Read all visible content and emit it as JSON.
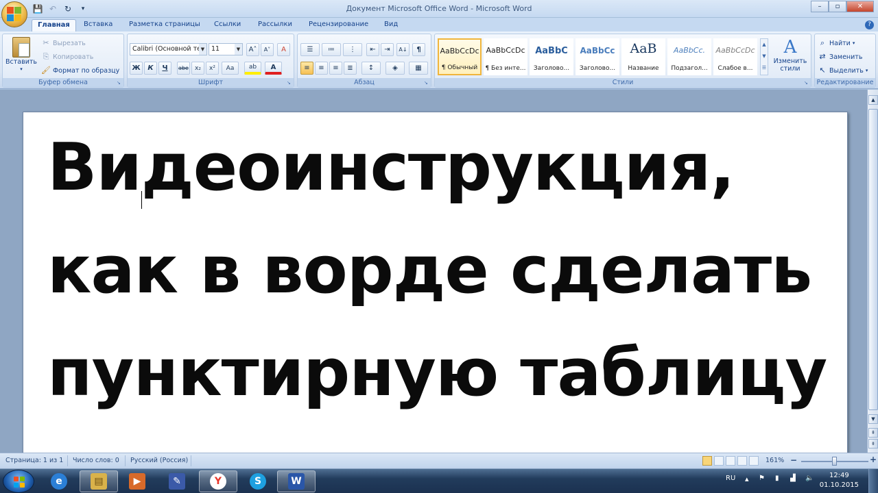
{
  "window": {
    "title": "Документ Microsoft Office Word - Microsoft Word",
    "controls": {
      "minimize": "–",
      "maximize": "▫",
      "close": "✕"
    }
  },
  "quick_access": {
    "save": "💾",
    "undo": "↶",
    "redo": "↻",
    "customize": "▾"
  },
  "tabs": [
    "Главная",
    "Вставка",
    "Разметка страницы",
    "Ссылки",
    "Рассылки",
    "Рецензирование",
    "Вид"
  ],
  "help": "?",
  "ribbon": {
    "clipboard": {
      "label": "Буфер обмена",
      "paste": "Вставить",
      "cut": "Вырезать",
      "copy": "Копировать",
      "format_painter": "Формат по образцу"
    },
    "font": {
      "label": "Шрифт",
      "font_name": "Calibri (Основной текст)",
      "font_size": "11",
      "grow": "A˄",
      "shrink": "A˅",
      "clear": "A",
      "bold": "Ж",
      "italic": "К",
      "underline": "Ч",
      "strike": "abe",
      "subscript": "x₂",
      "superscript": "x²",
      "case": "Aa",
      "highlight": "ab",
      "color": "A"
    },
    "paragraph": {
      "label": "Абзац",
      "show_marks": "¶",
      "sort": "A↓"
    },
    "styles": {
      "label": "Стили",
      "items": [
        {
          "sample": "AaBbCcDc",
          "name": "¶ Обычный"
        },
        {
          "sample": "AaBbCcDc",
          "name": "¶ Без инте..."
        },
        {
          "sample": "AaBbC",
          "name": "Заголово..."
        },
        {
          "sample": "AaBbCc",
          "name": "Заголово..."
        },
        {
          "sample": "AaB",
          "name": "Название"
        },
        {
          "sample": "AaBbCc.",
          "name": "Подзагол..."
        },
        {
          "sample": "AaBbCcDc",
          "name": "Слабое в..."
        }
      ],
      "change_styles_1": "Изменить",
      "change_styles_2": "стили"
    },
    "editing": {
      "label": "Редактирование",
      "find": "Найти",
      "replace": "Заменить",
      "select": "Выделить"
    }
  },
  "document": {
    "lines": [
      "Видеоинструкция,",
      "как в ворде сделать",
      "пунктирную таблицу"
    ]
  },
  "status": {
    "page": "Страница: 1 из 1",
    "words": "Число слов: 0",
    "language": "Русский (Россия)",
    "zoom": "161%",
    "zoom_minus": "−",
    "zoom_plus": "+"
  },
  "taskbar": {
    "apps": [
      {
        "name": "internet-explorer",
        "glyph": "e",
        "color": "#2b7fd6"
      },
      {
        "name": "file-explorer",
        "glyph": "▤",
        "color": "#d9b24a"
      },
      {
        "name": "media-player",
        "glyph": "▶",
        "color": "#d86a2a"
      },
      {
        "name": "paint-tool",
        "glyph": "✎",
        "color": "#3b5aa8"
      },
      {
        "name": "yandex-browser",
        "glyph": "Y",
        "color": "#e8372c"
      },
      {
        "name": "skype",
        "glyph": "S",
        "color": "#1ea0e0"
      },
      {
        "name": "word",
        "glyph": "W",
        "color": "#2a56a8"
      }
    ],
    "language": "RU",
    "time": "12:49",
    "date": "01.10.2015"
  },
  "colors": {
    "accent": "#15428b",
    "ribbon_bg": "#dbe6f4",
    "selected_style": "#f0b53c",
    "font_color_bar": "#e02020",
    "highlight_bar": "#ffee00"
  }
}
